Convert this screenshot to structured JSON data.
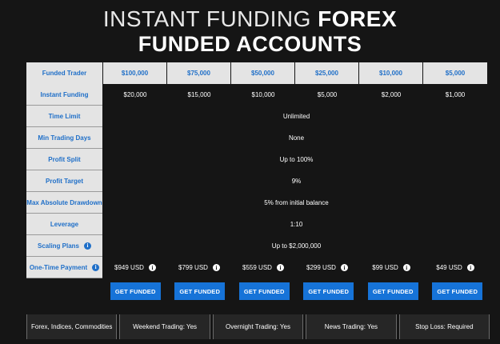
{
  "title": {
    "line1_thin": "INSTANT FUNDING",
    "line1_bold": "FOREX",
    "line2": "FUNDED ACCOUNTS"
  },
  "table": {
    "header_label": "Funded Trader",
    "accounts": [
      "$100,000",
      "$75,000",
      "$50,000",
      "$25,000",
      "$10,000",
      "$5,000"
    ],
    "instant_funding": {
      "label": "Instant Funding",
      "values": [
        "$20,000",
        "$15,000",
        "$10,000",
        "$5,000",
        "$2,000",
        "$1,000"
      ]
    },
    "time_limit": {
      "label": "Time Limit",
      "value": "Unlimited"
    },
    "min_trading_days": {
      "label": "Min Trading Days",
      "value": "None"
    },
    "profit_split": {
      "label": "Profit Split",
      "value": "Up to 100%"
    },
    "profit_target": {
      "label": "Profit Target",
      "value": "9%"
    },
    "max_drawdown": {
      "label": "Max Absolute Drawdown",
      "value": "5% from initial balance"
    },
    "leverage": {
      "label": "Leverage",
      "value": "1:10"
    },
    "scaling_plans": {
      "label": "Scaling Plans",
      "value": "Up to $2,000,000"
    },
    "one_time_payment": {
      "label": "One-Time Payment",
      "values": [
        "$949 USD",
        "$799 USD",
        "$559 USD",
        "$299 USD",
        "$99 USD",
        "$49 USD"
      ]
    }
  },
  "buttons": {
    "label": "GET FUNDED"
  },
  "features": [
    "Forex, Indices, Commodities",
    "Weekend Trading: Yes",
    "Overnight Trading: Yes",
    "News Trading: Yes",
    "Stop Loss: Required"
  ],
  "colors": {
    "background": "#151515",
    "accent_blue": "#1f6fc8",
    "button_blue": "#1673d8",
    "label_bg": "#e4e4e4"
  },
  "icons": {
    "info": "info-icon"
  }
}
